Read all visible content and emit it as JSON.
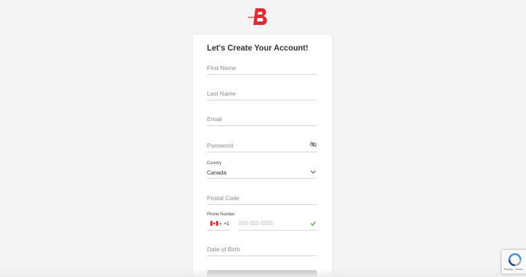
{
  "brand": {
    "logo_letter": "B",
    "brand_color": "#e8262b"
  },
  "form": {
    "title": "Let's Create Your Account!",
    "first_name_placeholder": "First Name",
    "last_name_placeholder": "Last Name",
    "email_placeholder": "Email",
    "password_placeholder": "Password",
    "country_label": "Country",
    "country_value": "Canada",
    "postal_code_placeholder": "Postal Code",
    "phone_label": "Phone Number",
    "phone_dial_code": "+1",
    "phone_placeholder": "555-555-5555",
    "dob_placeholder": "Date of Birth",
    "submit_color": "#c4c4c4",
    "valid_color": "#3aa63a"
  },
  "recaptcha": {
    "terms_text": "Privacy - Terms"
  }
}
